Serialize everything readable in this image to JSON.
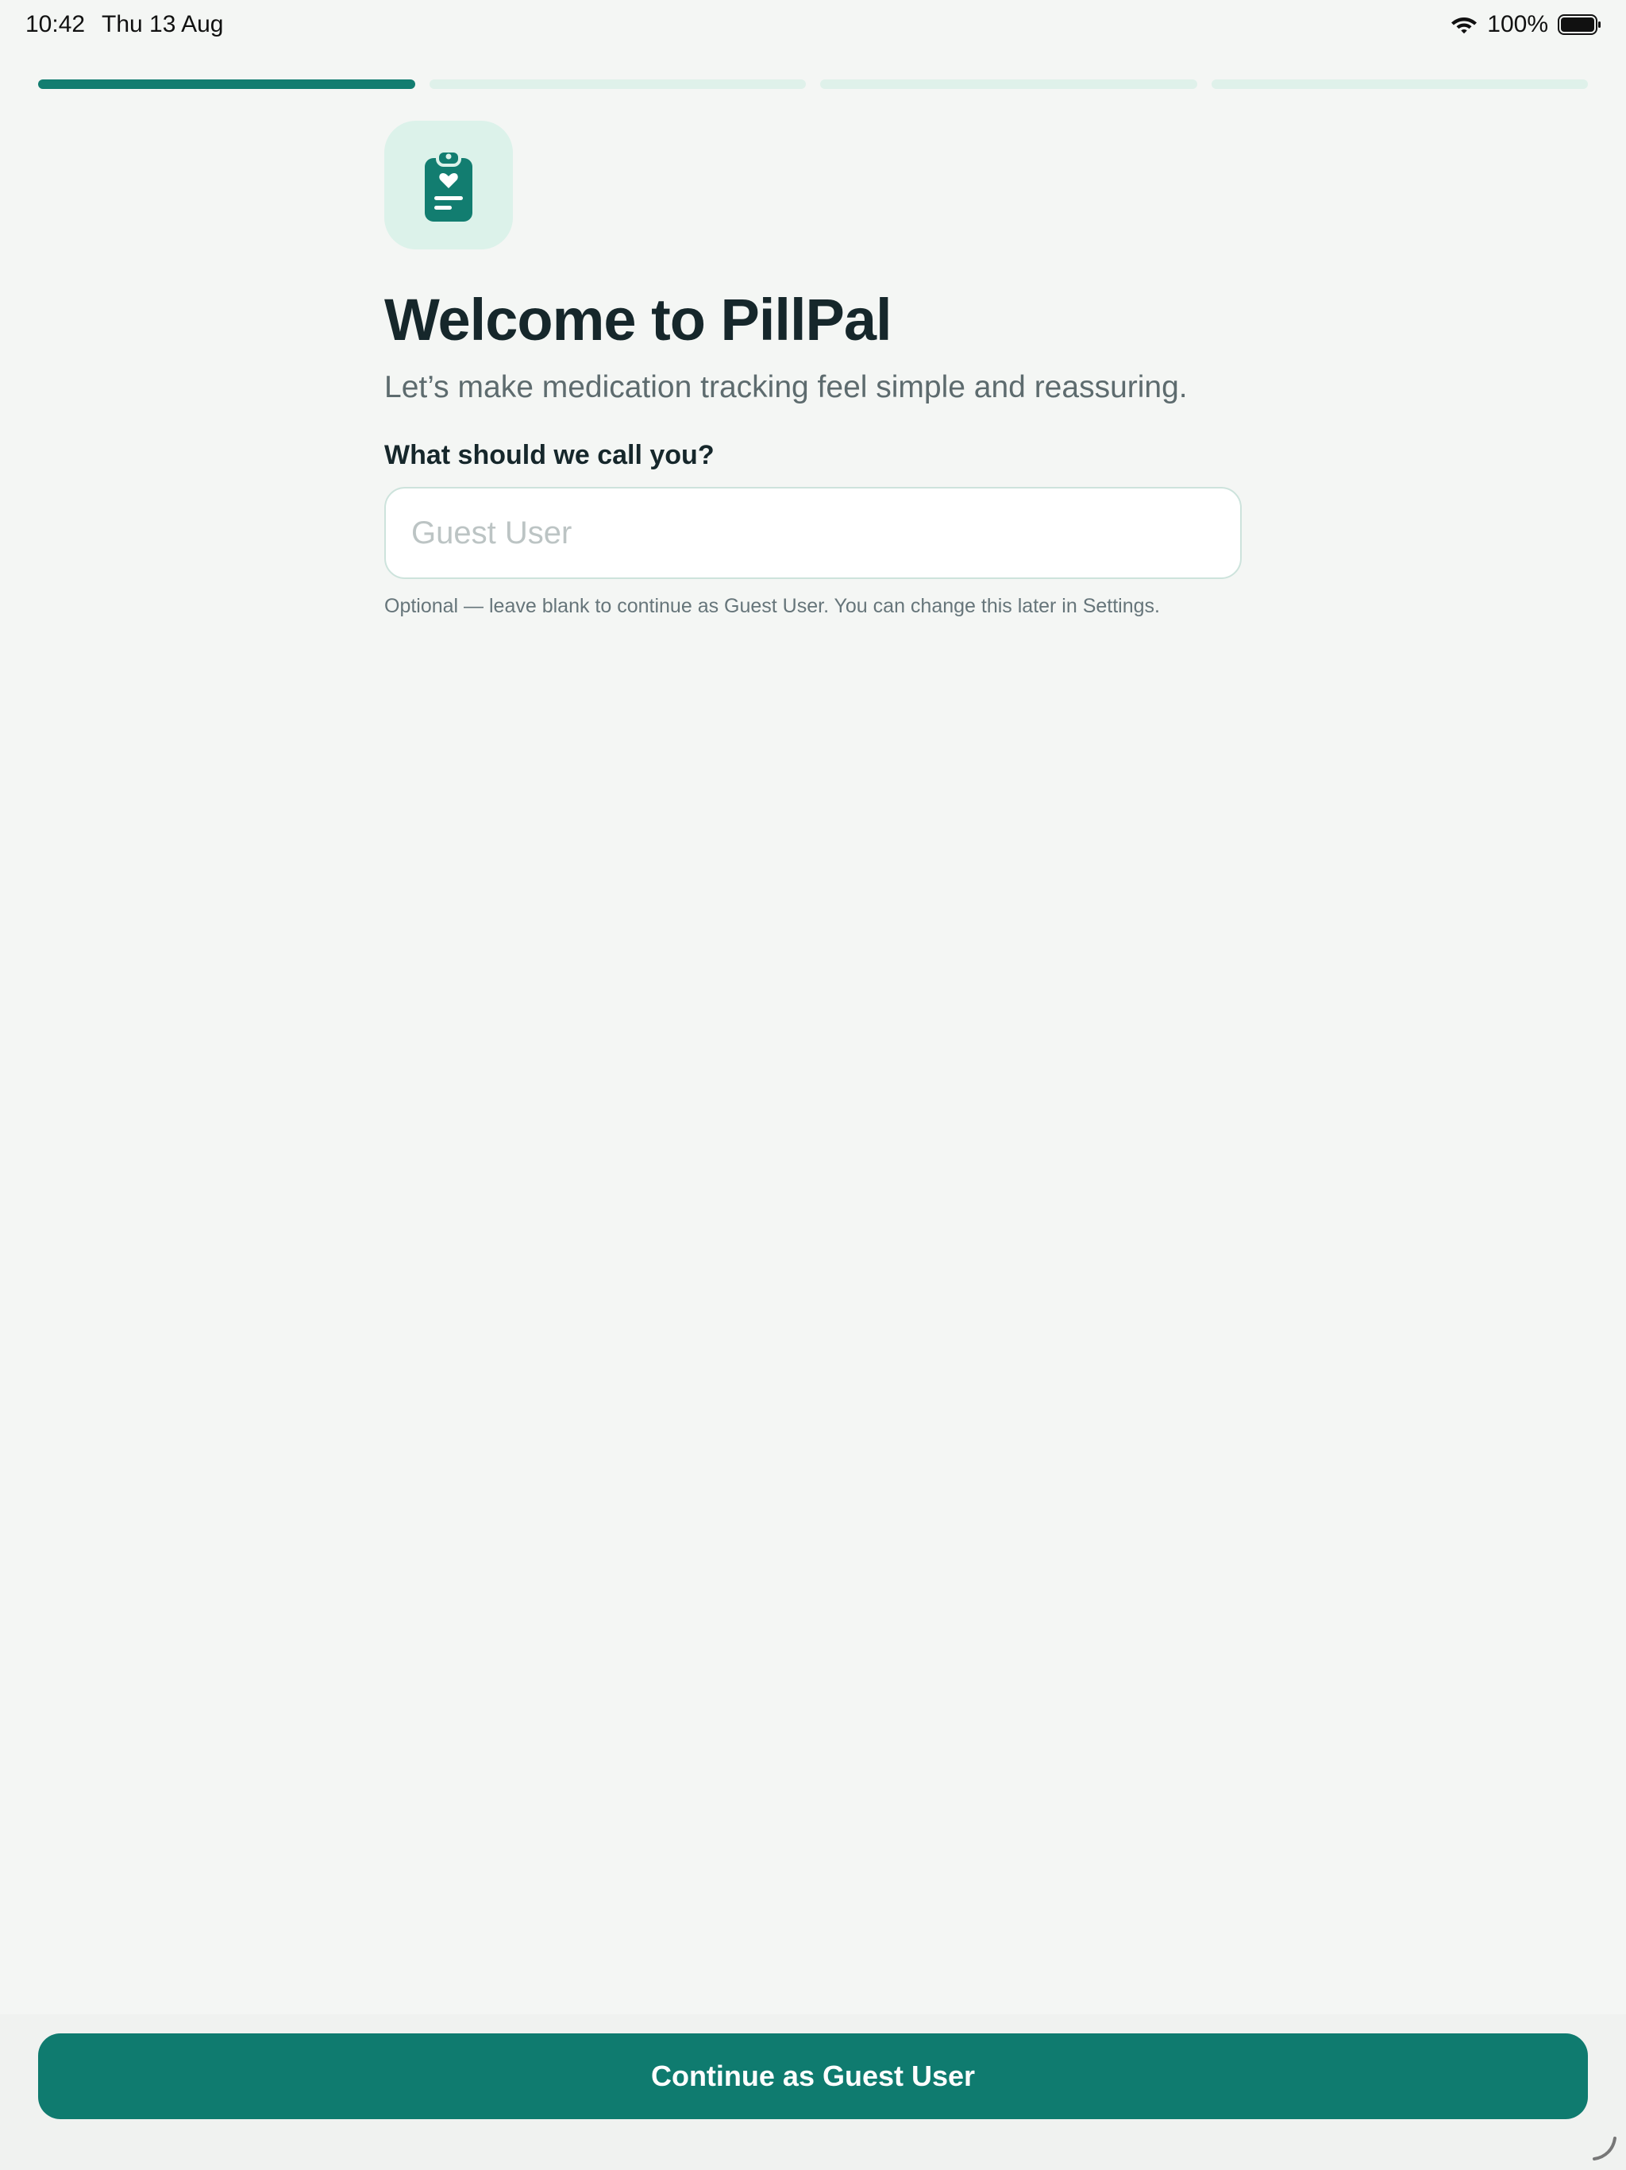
{
  "status_bar": {
    "time": "10:42",
    "date": "Thu 13 Aug",
    "battery": "100%"
  },
  "progress": {
    "total_steps": 4,
    "current_step": 1
  },
  "welcome": {
    "title": "Welcome to PillPal",
    "subtitle": "Let’s make medication tracking feel simple and reassuring.",
    "field_label": "What should we call you?",
    "name_value": "",
    "name_placeholder": "Guest User",
    "helper": "Optional — leave blank to continue as Guest User. You can change this later in Settings."
  },
  "footer": {
    "continue_label": "Continue as Guest User"
  },
  "colors": {
    "accent": "#0f7b6f",
    "accent_light": "#dcf2ea",
    "background": "#f4f6f4"
  },
  "icons": {
    "app": "clipboard-heart-icon"
  }
}
